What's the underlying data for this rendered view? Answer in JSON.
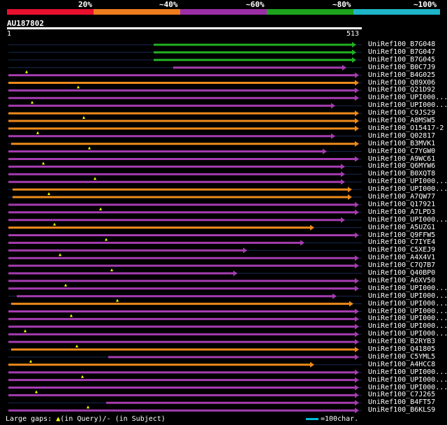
{
  "legend": {
    "labels": [
      "20%",
      "~40%",
      "~60%",
      "~80%",
      "~100%"
    ],
    "colors": [
      "#e8102e",
      "#ee7d1f",
      "#9b2fa5",
      "#1ea31e",
      "#1fb5c8"
    ]
  },
  "query": {
    "name": "AU187802",
    "start": "1",
    "end": "513"
  },
  "hits": [
    {
      "label": "UniRef100_B7G048",
      "color": "#2a2"
    },
    {
      "label": "UniRef100_B7G047",
      "color": "#2a2"
    },
    {
      "label": "UniRef100_B7G045",
      "color": "#2a2"
    },
    {
      "label": "UniRef100_B0C7J9",
      "color": "#a3a"
    },
    {
      "label": "UniRef100_B4G025",
      "color": "#a3a"
    },
    {
      "label": "UniRef100_Q89X06",
      "color": "#e80"
    },
    {
      "label": "UniRef100_Q21D92",
      "color": "#a3a"
    },
    {
      "label": "UniRef100_UPI000...",
      "color": "#a3a"
    },
    {
      "label": "UniRef100_UPI000...",
      "color": "#a3a"
    },
    {
      "label": "UniRef100_C9JS29",
      "color": "#e80"
    },
    {
      "label": "UniRef100_A8MSW5",
      "color": "#e80"
    },
    {
      "label": "UniRef100_O15417-2",
      "color": "#e80"
    },
    {
      "label": "UniRef100_Q02817",
      "color": "#a3a"
    },
    {
      "label": "UniRef100_B3MVK1",
      "color": "#e80"
    },
    {
      "label": "UniRef100_C7YGW0",
      "color": "#a3a"
    },
    {
      "label": "UniRef100_A9WC61",
      "color": "#a3a"
    },
    {
      "label": "UniRef100_Q6MYW6",
      "color": "#a3a"
    },
    {
      "label": "UniRef100_B0XQT8",
      "color": "#a3a"
    },
    {
      "label": "UniRef100_UPI000...",
      "color": "#a3a"
    },
    {
      "label": "UniRef100_UPI000...",
      "color": "#e80"
    },
    {
      "label": "UniRef100_A7QW77",
      "color": "#e80"
    },
    {
      "label": "UniRef100_Q17921",
      "color": "#a3a"
    },
    {
      "label": "UniRef100_A7LPD3",
      "color": "#a3a"
    },
    {
      "label": "UniRef100_UPI000...",
      "color": "#a3a"
    },
    {
      "label": "UniRef100_A5UZG1",
      "color": "#e80"
    },
    {
      "label": "UniRef100_Q9FFW5",
      "color": "#a3a"
    },
    {
      "label": "UniRef100_C7IYE4",
      "color": "#a3a"
    },
    {
      "label": "UniRef100_C5XEJ9",
      "color": "#a3a"
    },
    {
      "label": "UniRef100_A4X4V1",
      "color": "#a3a"
    },
    {
      "label": "UniRef100_C7Q7B7",
      "color": "#a3a"
    },
    {
      "label": "UniRef100_Q40BP0",
      "color": "#a3a"
    },
    {
      "label": "UniRef100_A6XV50",
      "color": "#a3a"
    },
    {
      "label": "UniRef100_UPI000...",
      "color": "#a3a"
    },
    {
      "label": "UniRef100_UPI000...",
      "color": "#a3a"
    },
    {
      "label": "UniRef100_UPI000...",
      "color": "#e80"
    },
    {
      "label": "UniRef100_UPI000...",
      "color": "#a3a"
    },
    {
      "label": "UniRef100_UPI000...",
      "color": "#a3a"
    },
    {
      "label": "UniRef100_UPI000...",
      "color": "#a3a"
    },
    {
      "label": "UniRef100_UPI000...",
      "color": "#a3a"
    },
    {
      "label": "UniRef100_B2RYB3",
      "color": "#a3a"
    },
    {
      "label": "UniRef100_Q41805",
      "color": "#e80"
    },
    {
      "label": "UniRef100_C5YML5",
      "color": "#a3a"
    },
    {
      "label": "UniRef100_A4HCC8",
      "color": "#e80"
    },
    {
      "label": "UniRef100_UPI000...",
      "color": "#a3a"
    },
    {
      "label": "UniRef100_UPI000...",
      "color": "#a3a"
    },
    {
      "label": "UniRef100_UPI000...",
      "color": "#a3a"
    },
    {
      "label": "UniRef100_C7J265",
      "color": "#a3a"
    },
    {
      "label": "UniRef100_B4FT57",
      "color": "#a3a"
    },
    {
      "label": "UniRef100_B6KLS9",
      "color": "#a3a"
    }
  ],
  "footer": {
    "large_gaps_prefix": "Large gaps: ",
    "in_query": "(in Query)/",
    "in_subject": " (in Subject)",
    "scale_label": "=100char."
  }
}
